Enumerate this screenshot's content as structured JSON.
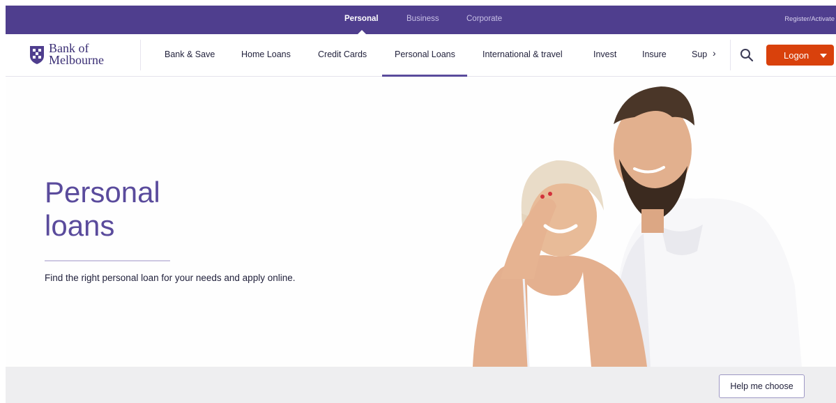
{
  "segments": {
    "items": [
      {
        "label": "Personal",
        "active": true
      },
      {
        "label": "Business",
        "active": false
      },
      {
        "label": "Corporate",
        "active": false
      }
    ],
    "register_label": "Register/Activate"
  },
  "brand": {
    "name_line1": "Bank of",
    "name_line2": "Melbourne",
    "primary_color": "#4f3e8e",
    "accent_color": "#d9410c"
  },
  "nav": {
    "items": [
      {
        "label": "Bank & Save"
      },
      {
        "label": "Home Loans"
      },
      {
        "label": "Credit Cards"
      },
      {
        "label": "Personal Loans",
        "active": true
      },
      {
        "label": "International & travel"
      },
      {
        "label": "Invest"
      },
      {
        "label": "Insure"
      },
      {
        "label": "Sup"
      }
    ],
    "more_icon": "chevron-right-icon",
    "search_icon": "search-icon",
    "logon_label": "Logon",
    "logon_icon": "caret-down-icon"
  },
  "hero": {
    "title_line1": "Personal",
    "title_line2": "loans",
    "subtitle": "Find the right personal loan for your needs and apply online.",
    "image": "smiling-couple-photo"
  },
  "footer_strip": {
    "help_label": "Help me choose"
  }
}
